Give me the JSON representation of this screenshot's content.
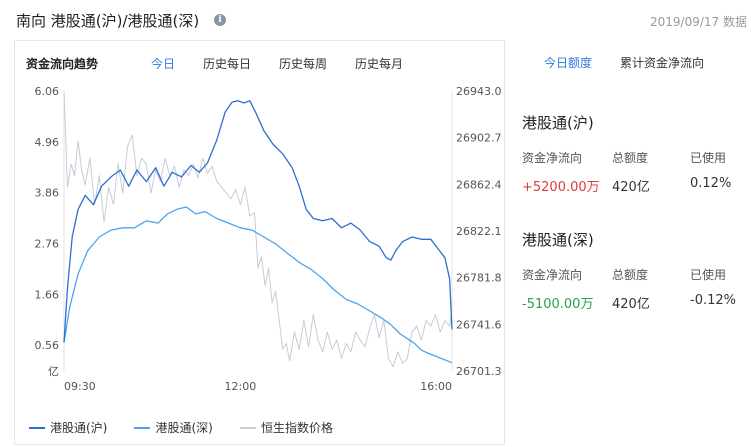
{
  "header": {
    "title": "南向 港股通(沪)/港股通(深)",
    "date": "2019/09/17 数据"
  },
  "left_tabs": {
    "heading": "资金流向趋势",
    "items": [
      "今日",
      "历史每日",
      "历史每周",
      "历史每月"
    ],
    "active": 0
  },
  "legend": [
    "港股通(沪)",
    "港股通(深)",
    "恒生指数价格"
  ],
  "right_tabs": {
    "items": [
      "今日额度",
      "累计资金净流向"
    ],
    "active": 0
  },
  "sections": [
    {
      "title": "港股通(沪)",
      "headers": [
        "资金净流向",
        "总额度",
        "已使用"
      ],
      "values": [
        "+5200.00万",
        "420亿",
        "0.12%"
      ]
    },
    {
      "title": "港股通(深)",
      "headers": [
        "资金净流向",
        "总额度",
        "已使用"
      ],
      "values": [
        "-5100.00万",
        "420亿",
        "-0.12%"
      ]
    }
  ],
  "colors": {
    "hu": "#2c6fd1",
    "shen": "#4ea4ec",
    "hsi": "#c5ccd6",
    "accent": "#2c7be5",
    "positive": "#e03a3a",
    "negative": "#2aa24b"
  },
  "chart_data": {
    "type": "line",
    "x_ticks": [
      "09:30",
      "12:00",
      "16:00"
    ],
    "y_left_ticks": [
      "6.06",
      "4.96",
      "3.86",
      "2.76",
      "1.66",
      "0.56"
    ],
    "y_left_unit": "亿",
    "y_left_range": [
      0.0,
      6.06
    ],
    "y_right_ticks": [
      "26943.0",
      "26902.7",
      "26862.4",
      "26822.1",
      "26781.8",
      "26741.6",
      "26701.3"
    ],
    "y_right_range": [
      26701.3,
      26943.0
    ],
    "x_domain": [
      0,
      330
    ],
    "series": [
      {
        "name": "港股通(沪)",
        "axis": "left",
        "points": [
          [
            0,
            0.62
          ],
          [
            3,
            1.8
          ],
          [
            7,
            2.9
          ],
          [
            12,
            3.5
          ],
          [
            18,
            3.8
          ],
          [
            25,
            3.6
          ],
          [
            32,
            4.0
          ],
          [
            40,
            4.2
          ],
          [
            48,
            4.35
          ],
          [
            55,
            4.0
          ],
          [
            62,
            4.35
          ],
          [
            70,
            4.1
          ],
          [
            78,
            4.4
          ],
          [
            85,
            4.0
          ],
          [
            92,
            4.3
          ],
          [
            100,
            4.2
          ],
          [
            108,
            4.45
          ],
          [
            115,
            4.3
          ],
          [
            122,
            4.5
          ],
          [
            130,
            5.0
          ],
          [
            137,
            5.6
          ],
          [
            143,
            5.82
          ],
          [
            148,
            5.85
          ],
          [
            153,
            5.8
          ],
          [
            158,
            5.85
          ],
          [
            163,
            5.6
          ],
          [
            170,
            5.2
          ],
          [
            178,
            4.9
          ],
          [
            186,
            4.7
          ],
          [
            194,
            4.4
          ],
          [
            200,
            4.0
          ],
          [
            206,
            3.5
          ],
          [
            212,
            3.3
          ],
          [
            220,
            3.25
          ],
          [
            228,
            3.3
          ],
          [
            236,
            3.1
          ],
          [
            244,
            3.2
          ],
          [
            252,
            3.05
          ],
          [
            260,
            2.8
          ],
          [
            268,
            2.7
          ],
          [
            274,
            2.45
          ],
          [
            278,
            2.4
          ],
          [
            282,
            2.6
          ],
          [
            288,
            2.8
          ],
          [
            296,
            2.9
          ],
          [
            304,
            2.85
          ],
          [
            312,
            2.85
          ],
          [
            318,
            2.65
          ],
          [
            324,
            2.45
          ],
          [
            328,
            2.0
          ],
          [
            330,
            0.9
          ]
        ]
      },
      {
        "name": "港股通(深)",
        "axis": "left",
        "points": [
          [
            0,
            0.62
          ],
          [
            5,
            1.4
          ],
          [
            12,
            2.1
          ],
          [
            20,
            2.6
          ],
          [
            30,
            2.9
          ],
          [
            40,
            3.05
          ],
          [
            50,
            3.1
          ],
          [
            60,
            3.1
          ],
          [
            70,
            3.25
          ],
          [
            80,
            3.2
          ],
          [
            88,
            3.4
          ],
          [
            96,
            3.5
          ],
          [
            104,
            3.55
          ],
          [
            112,
            3.4
          ],
          [
            120,
            3.45
          ],
          [
            130,
            3.3
          ],
          [
            140,
            3.2
          ],
          [
            150,
            3.1
          ],
          [
            160,
            3.05
          ],
          [
            170,
            2.9
          ],
          [
            180,
            2.75
          ],
          [
            190,
            2.55
          ],
          [
            200,
            2.35
          ],
          [
            210,
            2.2
          ],
          [
            220,
            2.0
          ],
          [
            230,
            1.75
          ],
          [
            240,
            1.55
          ],
          [
            250,
            1.45
          ],
          [
            260,
            1.3
          ],
          [
            270,
            1.15
          ],
          [
            278,
            1.0
          ],
          [
            286,
            0.8
          ],
          [
            292,
            0.7
          ],
          [
            298,
            0.6
          ],
          [
            304,
            0.45
          ],
          [
            310,
            0.38
          ],
          [
            318,
            0.3
          ],
          [
            326,
            0.22
          ],
          [
            330,
            0.18
          ]
        ]
      },
      {
        "name": "恒生指数价格",
        "axis": "right",
        "points": [
          [
            0,
            26943.0
          ],
          [
            3,
            26860
          ],
          [
            6,
            26880
          ],
          [
            9,
            26870
          ],
          [
            12,
            26900
          ],
          [
            15,
            26875
          ],
          [
            18,
            26862
          ],
          [
            22,
            26885
          ],
          [
            26,
            26845
          ],
          [
            30,
            26870
          ],
          [
            34,
            26830
          ],
          [
            38,
            26860
          ],
          [
            42,
            26845
          ],
          [
            46,
            26880
          ],
          [
            50,
            26855
          ],
          [
            54,
            26895
          ],
          [
            58,
            26905
          ],
          [
            62,
            26870
          ],
          [
            66,
            26885
          ],
          [
            70,
            26880
          ],
          [
            74,
            26855
          ],
          [
            78,
            26875
          ],
          [
            82,
            26865
          ],
          [
            86,
            26885
          ],
          [
            90,
            26870
          ],
          [
            94,
            26878
          ],
          [
            98,
            26860
          ],
          [
            102,
            26875
          ],
          [
            106,
            26870
          ],
          [
            110,
            26880
          ],
          [
            114,
            26868
          ],
          [
            118,
            26885
          ],
          [
            122,
            26872
          ],
          [
            126,
            26878
          ],
          [
            130,
            26865
          ],
          [
            134,
            26860
          ],
          [
            138,
            26855
          ],
          [
            142,
            26850
          ],
          [
            146,
            26858
          ],
          [
            150,
            26845
          ],
          [
            154,
            26860
          ],
          [
            158,
            26835
          ],
          [
            162,
            26838
          ],
          [
            165,
            26790
          ],
          [
            168,
            26800
          ],
          [
            171,
            26775
          ],
          [
            174,
            26790
          ],
          [
            177,
            26760
          ],
          [
            180,
            26770
          ],
          [
            183,
            26745
          ],
          [
            186,
            26720
          ],
          [
            189,
            26725
          ],
          [
            192,
            26710
          ],
          [
            196,
            26735
          ],
          [
            200,
            26720
          ],
          [
            204,
            26745
          ],
          [
            208,
            26722
          ],
          [
            212,
            26750
          ],
          [
            216,
            26728
          ],
          [
            220,
            26718
          ],
          [
            224,
            26735
          ],
          [
            228,
            26720
          ],
          [
            232,
            26728
          ],
          [
            236,
            26712
          ],
          [
            240,
            26725
          ],
          [
            244,
            26718
          ],
          [
            248,
            26735
          ],
          [
            252,
            26728
          ],
          [
            256,
            26722
          ],
          [
            260,
            26738
          ],
          [
            264,
            26750
          ],
          [
            268,
            26730
          ],
          [
            272,
            26745
          ],
          [
            276,
            26712
          ],
          [
            280,
            26705
          ],
          [
            284,
            26718
          ],
          [
            288,
            26708
          ],
          [
            292,
            26712
          ],
          [
            296,
            26735
          ],
          [
            300,
            26740
          ],
          [
            304,
            26728
          ],
          [
            308,
            26745
          ],
          [
            312,
            26740
          ],
          [
            316,
            26750
          ],
          [
            320,
            26735
          ],
          [
            324,
            26745
          ],
          [
            328,
            26740
          ],
          [
            330,
            26755
          ]
        ]
      }
    ]
  }
}
